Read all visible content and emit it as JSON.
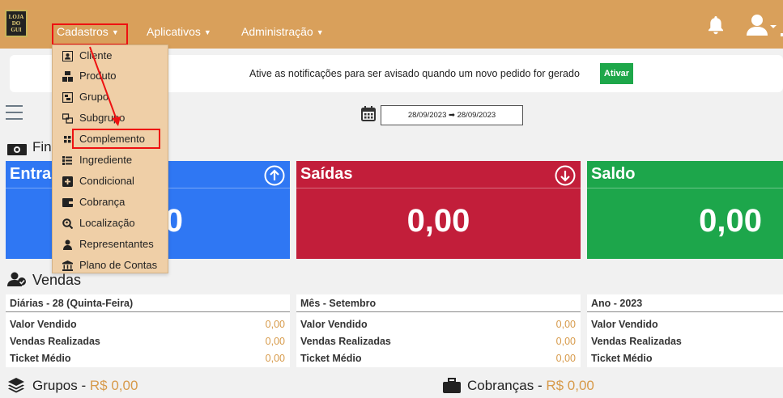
{
  "logo": {
    "lines": [
      "LOJA",
      "DO",
      "GUI"
    ]
  },
  "nav": {
    "items": [
      {
        "label": "Cadastros"
      },
      {
        "label": "Aplicativos"
      },
      {
        "label": "Administração"
      }
    ]
  },
  "notification": {
    "text": "Ative as notificações para ser avisado quando um novo pedido for gerado",
    "button": "Ativar"
  },
  "date_range": "28/09/2023 ➡ 28/09/2023",
  "financeiro": {
    "title": "Fin"
  },
  "cards": [
    {
      "title": "Entra",
      "value": "0",
      "color": "#2f77f3"
    },
    {
      "title": "Saídas",
      "value": "0,00",
      "color": "#c21e3a"
    },
    {
      "title": "Saldo",
      "value": "0,00",
      "color": "#1da64b"
    }
  ],
  "vendas": {
    "title": "Vendas",
    "panels": [
      {
        "header": "Diárias - 28 (Quinta-Feira)",
        "rows": [
          {
            "label": "Valor Vendido",
            "value": "0,00"
          },
          {
            "label": "Vendas Realizadas",
            "value": "0,00"
          },
          {
            "label": "Ticket Médio",
            "value": "0,00"
          }
        ]
      },
      {
        "header": "Mês - Setembro",
        "rows": [
          {
            "label": "Valor Vendido",
            "value": "0,00"
          },
          {
            "label": "Vendas Realizadas",
            "value": "0,00"
          },
          {
            "label": "Ticket Médio",
            "value": "0,00"
          }
        ]
      },
      {
        "header": "Ano - 2023",
        "rows": [
          {
            "label": "Valor Vendido",
            "value": ""
          },
          {
            "label": "Vendas Realizadas",
            "value": ""
          },
          {
            "label": "Ticket Médio",
            "value": ""
          }
        ]
      }
    ]
  },
  "grupos": {
    "title": "Grupos",
    "sep": " - ",
    "value": "R$ 0,00"
  },
  "cobrancas": {
    "title": "Cobranças",
    "sep": " - ",
    "value": "R$ 0,00"
  },
  "dropdown": {
    "items": [
      {
        "label": "Cliente",
        "icon": "id-card-icon"
      },
      {
        "label": "Produto",
        "icon": "boxes-icon"
      },
      {
        "label": "Grupo",
        "icon": "object-group-icon"
      },
      {
        "label": "Subgrupo",
        "icon": "object-ungroup-icon"
      },
      {
        "label": "Complemento",
        "icon": "grip-icon"
      },
      {
        "label": "Ingrediente",
        "icon": "list-icon"
      },
      {
        "label": "Condicional",
        "icon": "plus-square-icon"
      },
      {
        "label": "Cobrança",
        "icon": "wallet-icon"
      },
      {
        "label": "Localização",
        "icon": "search-location-icon"
      },
      {
        "label": "Representantes",
        "icon": "user-tie-icon"
      },
      {
        "label": "Plano de Contas",
        "icon": "bank-icon"
      }
    ]
  },
  "colors": {
    "topbar": "#d9a05b",
    "dropdown": "#efcfa7",
    "accent": "#d79a4a",
    "highlight": "#ee1111"
  }
}
